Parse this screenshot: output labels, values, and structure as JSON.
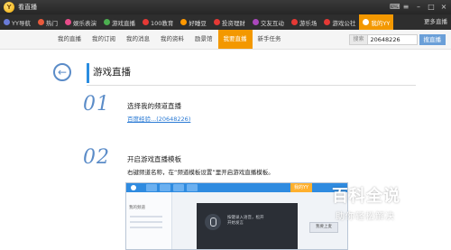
{
  "window": {
    "title": "看直播"
  },
  "nav": {
    "items": [
      {
        "label": "YY导航",
        "color": "#6a7bd8"
      },
      {
        "label": "热门",
        "color": "#e85a3c"
      },
      {
        "label": "娱乐表演",
        "color": "#e84c8a"
      },
      {
        "label": "游戏直播",
        "color": "#4caf50"
      },
      {
        "label": "100教育",
        "color": "#e53935"
      },
      {
        "label": "好睡豆",
        "color": "#ff9800"
      },
      {
        "label": "投资理财",
        "color": "#e53935"
      },
      {
        "label": "交友互动",
        "color": "#ab47bc"
      },
      {
        "label": "游乐场",
        "color": "#e53935"
      },
      {
        "label": "游戏公社",
        "color": "#e53935"
      },
      {
        "label": "我的YY",
        "color": "#ffffff"
      }
    ],
    "more_label": "更多直播"
  },
  "subnav": {
    "tabs": [
      "我的直播",
      "我的订阅",
      "我的消息",
      "我的资料",
      "励景馆",
      "我要直播",
      "新手任务"
    ],
    "active_index": 5,
    "search_label": "搜索",
    "search_value": "20648226",
    "search_button": "搜直播"
  },
  "page": {
    "title": "游戏直播",
    "steps": [
      {
        "number": "01",
        "title": "选择我的频道直播",
        "link": "百度经验...(20648226)"
      },
      {
        "number": "02",
        "title": "开启游戏直播模板",
        "desc": "右键频道名称，在“频道模板设置”里开启游戏直播模板。"
      }
    ]
  },
  "inset": {
    "left_label": "我的频道",
    "dark_text_1": "按键录入语音，松开",
    "dark_text_2": "开始发言",
    "button_label": "我要上麦",
    "tab_label": "我的YY"
  },
  "watermark": {
    "main": "百科全说",
    "sub": "助你轻松解决"
  }
}
